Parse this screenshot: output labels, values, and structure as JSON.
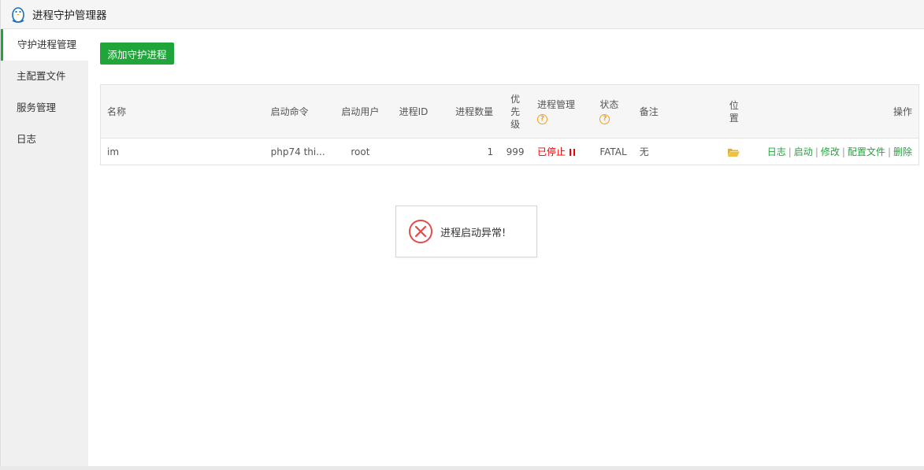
{
  "window": {
    "title": "进程守护管理器"
  },
  "sidebar": {
    "items": [
      {
        "label": "守护进程管理",
        "active": true
      },
      {
        "label": "主配置文件",
        "active": false
      },
      {
        "label": "服务管理",
        "active": false
      },
      {
        "label": "日志",
        "active": false
      }
    ]
  },
  "toolbar": {
    "add_label": "添加守护进程"
  },
  "table": {
    "headers": {
      "name": "名称",
      "cmd": "启动命令",
      "user": "启动用户",
      "pid": "进程ID",
      "num": "进程数量",
      "priority": [
        "优",
        "先",
        "级"
      ],
      "manager": "进程管理",
      "state": "状态",
      "note": "备注",
      "position": [
        "位",
        "置"
      ],
      "ops": "操作"
    },
    "rows": [
      {
        "name": "im",
        "cmd": "php74 thi...",
        "user": "root",
        "pid": "",
        "num": "1",
        "priority": "999",
        "manager_status": "已停止",
        "state": "FATAL",
        "note": "无",
        "ops": {
          "log": "日志",
          "start": "启动",
          "edit": "修改",
          "config": "配置文件",
          "delete": "删除"
        }
      }
    ]
  },
  "toast": {
    "message": "进程启动异常!"
  },
  "colors": {
    "accent": "#20a53a",
    "error": "#e00000",
    "warning": "#f0a020",
    "folder": "#f0c040"
  }
}
